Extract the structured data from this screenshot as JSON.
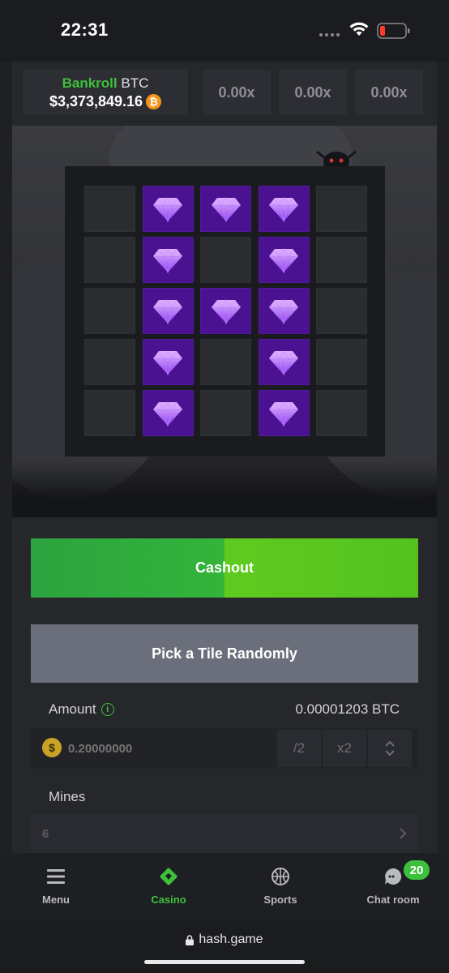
{
  "status_bar": {
    "time": "22:31"
  },
  "header": {
    "bankroll_label": "Bankroll",
    "bankroll_currency": "BTC",
    "bankroll_value": "$3,373,849.16",
    "multipliers": [
      "0.00x",
      "0.00x",
      "0.00x"
    ]
  },
  "board": {
    "rows": 5,
    "cols": 5,
    "revealed_gems": [
      [
        0,
        1
      ],
      [
        0,
        2
      ],
      [
        0,
        3
      ],
      [
        1,
        1
      ],
      [
        1,
        3
      ],
      [
        2,
        1
      ],
      [
        2,
        2
      ],
      [
        2,
        3
      ],
      [
        3,
        1
      ],
      [
        3,
        3
      ],
      [
        4,
        1
      ],
      [
        4,
        3
      ]
    ]
  },
  "controls": {
    "cashout_label": "Cashout",
    "pick_random_label": "Pick a Tile Randomly",
    "amount_label": "Amount",
    "amount_btc": "0.00001203 BTC",
    "amount_placeholder": "0.20000000",
    "coin_symbol": "$",
    "half_label": "/2",
    "double_label": "x2",
    "mines_label": "Mines",
    "mines_value": "6"
  },
  "nav": {
    "items": [
      {
        "label": "Menu",
        "icon": "menu-icon",
        "active": false
      },
      {
        "label": "Casino",
        "icon": "casino-icon",
        "active": true
      },
      {
        "label": "Sports",
        "icon": "sports-icon",
        "active": false
      },
      {
        "label": "Chat room",
        "icon": "chat-icon",
        "active": false
      }
    ],
    "chat_badge": "20"
  },
  "browser": {
    "url": "hash.game"
  },
  "colors": {
    "accent_green": "#3dc13c",
    "gem_tile": "#4a1290",
    "btc_orange": "#f7931a"
  }
}
